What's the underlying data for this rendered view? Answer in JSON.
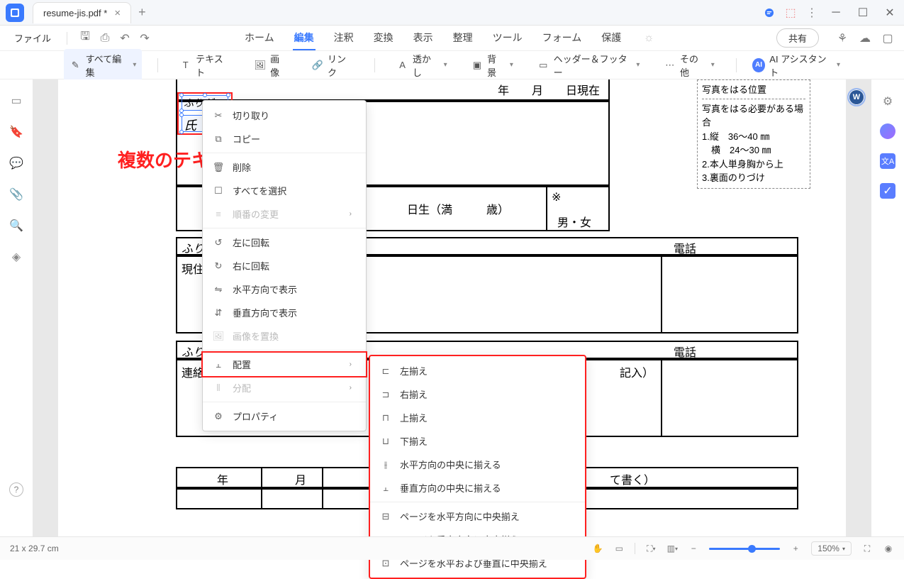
{
  "titlebar": {
    "tab_title": "resume-jis.pdf *"
  },
  "menubar": {
    "file": "ファイル",
    "tabs": [
      "ホーム",
      "編集",
      "注釈",
      "変換",
      "表示",
      "整理",
      "ツール",
      "フォーム",
      "保護"
    ],
    "active_tab": "編集",
    "share": "共有"
  },
  "toolbar": {
    "edit_all": "すべて編集",
    "text": "テキスト",
    "image": "画像",
    "link": "リンク",
    "watermark": "透かし",
    "background": "背景",
    "header_footer": "ヘッダー＆フッター",
    "other": "その他",
    "ai": "AI アシスタント"
  },
  "doc": {
    "top_date": "年　　月　　日現在",
    "furigana": "ふりが",
    "shi": "氏",
    "birth_suffix": "日生（満　　　歳）",
    "gender_mark": "※",
    "gender": "男・女",
    "furigana2": "ふりがな",
    "address": "現住所",
    "furigana3": "ふりがな",
    "contact": "連絡先",
    "contact_note": "記入）",
    "phone": "電話",
    "year": "年",
    "month": "月",
    "history_note": "て書く）",
    "photo_title": "写真をはる位置",
    "photo_line1": "写真をはる必要がある場合",
    "photo_line2": "1.縦　36～40 ㎜",
    "photo_line3": "　横　24～30 ㎜",
    "photo_line4": "2.本人単身胸から上",
    "photo_line5": "3.裏面のりづけ"
  },
  "annotation": "複数のテキストを選択",
  "context": {
    "cut": "切り取り",
    "copy": "コピー",
    "delete": "削除",
    "select_all": "すべてを選択",
    "reorder": "順番の変更",
    "rotate_left": "左に回転",
    "rotate_right": "右に回転",
    "show_horizontal": "水平方向で表示",
    "show_vertical": "垂直方向で表示",
    "replace_image": "画像を置換",
    "alignment": "配置",
    "distribute": "分配",
    "properties": "プロパティ"
  },
  "align_submenu": {
    "left": "左揃え",
    "right": "右揃え",
    "top": "上揃え",
    "bottom": "下揃え",
    "center_h": "水平方向の中央に揃える",
    "center_v": "垂直方向の中央に揃える",
    "page_center_h": "ページを水平方向に中央揃え",
    "page_center_v": "ページを垂直方向に中央揃え",
    "page_center_both": "ページを水平および垂直に中央揃え"
  },
  "status": {
    "dims": "21 x 29.7 cm",
    "zoom": "150%"
  }
}
